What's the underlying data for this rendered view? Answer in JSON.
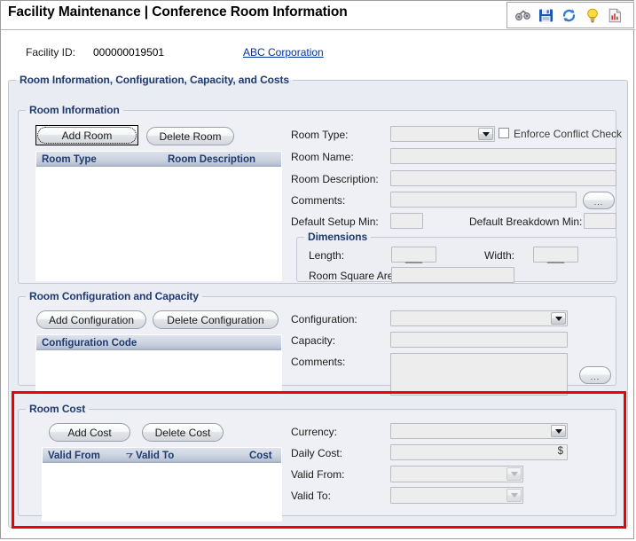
{
  "window": {
    "title": "Facility Maintenance | Conference Room Information"
  },
  "toolbar": {
    "icons": [
      {
        "name": "binoculars-icon",
        "label": "Search"
      },
      {
        "name": "save-icon",
        "label": "Save"
      },
      {
        "name": "refresh-icon",
        "label": "Refresh"
      },
      {
        "name": "lightbulb-icon",
        "label": "Hints"
      },
      {
        "name": "report-icon",
        "label": "Report"
      }
    ]
  },
  "facility": {
    "id_label": "Facility ID:",
    "id_value": "000000019501",
    "organization_link": "ABC Corporation"
  },
  "outer_group": {
    "legend": "Room Information, Configuration, Capacity,  and Costs"
  },
  "room_information": {
    "legend": "Room Information",
    "add_button": "Add Room",
    "delete_button": "Delete Room",
    "grid": {
      "columns": [
        "Room Type",
        "Room Description"
      ],
      "rows": []
    },
    "fields": {
      "room_type_label": "Room Type:",
      "room_type_value": "",
      "enforce_conflict_check_label": "Enforce Conflict Check",
      "enforce_conflict_check_value": false,
      "room_name_label": "Room Name:",
      "room_name_value": "",
      "room_description_label": "Room Description:",
      "room_description_value": "",
      "comments_label": "Comments:",
      "comments_value": "",
      "comments_ellipsis": "...",
      "default_setup_min_label": "Default Setup Min:",
      "default_setup_min_value": "",
      "default_breakdown_min_label": "Default Breakdown Min:",
      "default_breakdown_min_value": ""
    },
    "dimensions": {
      "legend": "Dimensions",
      "length_label": "Length:",
      "length_value": "",
      "length_mask": "___",
      "width_label": "Width:",
      "width_value": "",
      "width_mask": "___",
      "room_square_area_label": "Room Square Area:",
      "room_square_area_value": ""
    }
  },
  "room_configuration": {
    "legend": "Room Configuration and Capacity",
    "add_button": "Add Configuration",
    "delete_button": "Delete Configuration",
    "grid": {
      "columns": [
        "Configuration Code"
      ],
      "rows": []
    },
    "fields": {
      "configuration_label": "Configuration:",
      "configuration_value": "",
      "capacity_label": "Capacity:",
      "capacity_value": "",
      "comments_label": "Comments:",
      "comments_value": "",
      "comments_ellipsis": "..."
    }
  },
  "room_cost": {
    "legend": "Room Cost",
    "add_button": "Add Cost",
    "delete_button": "Delete Cost",
    "grid": {
      "columns": [
        "Valid From",
        "Valid To",
        "Cost"
      ],
      "sorted_column": "Valid To",
      "sort_direction": "descending",
      "rows": []
    },
    "fields": {
      "currency_label": "Currency:",
      "currency_value": "",
      "daily_cost_label": "Daily Cost:",
      "daily_cost_value": "",
      "daily_cost_suffix": "$",
      "valid_from_label": "Valid From:",
      "valid_from_value": "",
      "valid_to_label": "Valid To:",
      "valid_to_value": ""
    }
  },
  "colors": {
    "legend_text": "#1f3a6e",
    "link": "#0033a0",
    "highlight_border": "#ee0000",
    "panel_bg": "#e9ecf3",
    "input_bg": "#ededed"
  }
}
